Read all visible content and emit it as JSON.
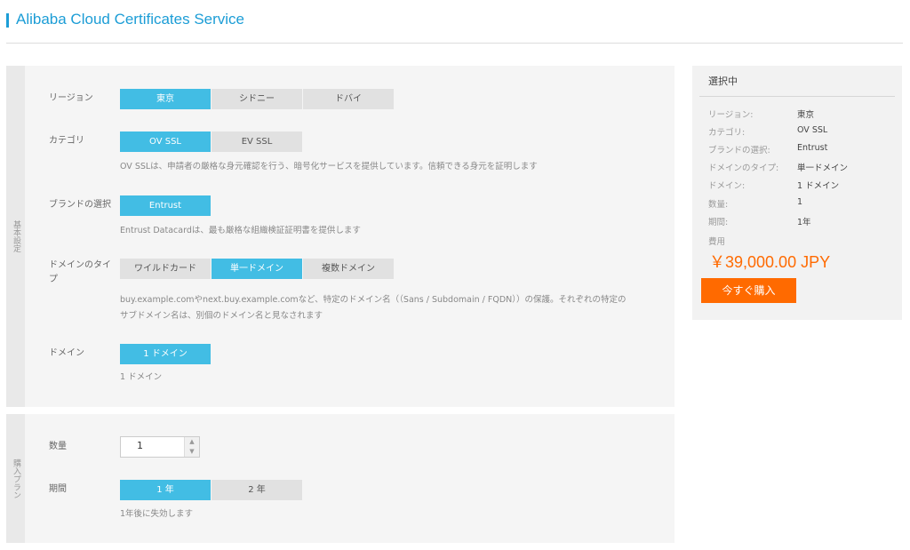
{
  "header": {
    "title": "Alibaba Cloud Certificates Service"
  },
  "basic": {
    "tab_label": "基本設定",
    "region": {
      "label": "リージョン",
      "options": [
        "東京",
        "シドニー",
        "ドバイ"
      ],
      "selected": 0
    },
    "category": {
      "label": "カテゴリ",
      "options": [
        "OV SSL",
        "EV SSL"
      ],
      "selected": 0,
      "hint": "OV SSLは、申請者の厳格な身元確認を行う、暗号化サービスを提供しています。信頼できる身元を証明します"
    },
    "brand": {
      "label": "ブランドの選択",
      "options": [
        "Entrust"
      ],
      "selected": 0,
      "hint": "Entrust Datacardは、最も厳格な組織検証証明書を提供します"
    },
    "domain_type": {
      "label_line1": "ドメインのタイ",
      "label_line2": "プ",
      "options": [
        "ワイルドカード",
        "単一ドメイン",
        "複数ドメイン"
      ],
      "selected": 1,
      "hint_line1": "buy.example.comやnext.buy.example.comなど、特定のドメイン名（（Sans / Subdomain / FQDN））の保護。それぞれの特定の",
      "hint_line2": "サブドメイン名は、別個のドメイン名と見なされます"
    },
    "domain": {
      "label": "ドメイン",
      "options": [
        "1 ドメイン"
      ],
      "selected": 0,
      "hint": "1 ドメイン"
    }
  },
  "plan": {
    "tab_label": "購入プラン",
    "quantity": {
      "label": "数量",
      "value": "1",
      "up_icon": "▲",
      "down_icon": "▼"
    },
    "period": {
      "label": "期間",
      "options": [
        "1 年",
        "2 年"
      ],
      "selected": 0,
      "hint": "1年後に失効します"
    }
  },
  "summary": {
    "title": "選択中",
    "items": [
      {
        "key": "リージョン:",
        "value": "東京"
      },
      {
        "key": "カテゴリ:",
        "value": "OV SSL"
      },
      {
        "key": "ブランドの選択:",
        "value": "Entrust"
      },
      {
        "key": "ドメインのタイプ:",
        "value": "単一ドメイン"
      },
      {
        "key": "ドメイン:",
        "value": "1 ドメイン"
      },
      {
        "key": "数量:",
        "value": "1"
      },
      {
        "key": "期間:",
        "value": "1年"
      }
    ],
    "fee_label": "費用",
    "price": "￥39,000.00 JPY",
    "buy_label": "今すぐ購入"
  },
  "colors": {
    "accent": "#1c9dd6",
    "selected": "#42bde4",
    "buy": "#ff6a00"
  }
}
